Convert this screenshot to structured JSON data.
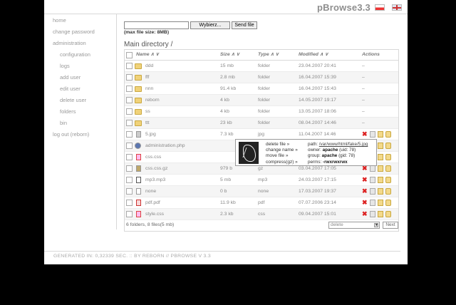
{
  "app": {
    "title": "pBrowse3.3"
  },
  "sidebar": {
    "items": [
      {
        "label": "home",
        "level": "top"
      },
      {
        "label": "change password",
        "level": "top"
      },
      {
        "label": "administration",
        "level": "top"
      },
      {
        "label": "configuration",
        "level": "sub"
      },
      {
        "label": "logs",
        "level": "sub"
      },
      {
        "label": "add user",
        "level": "sub"
      },
      {
        "label": "edit user",
        "level": "sub"
      },
      {
        "label": "delete user",
        "level": "sub"
      },
      {
        "label": "folders",
        "level": "sub"
      },
      {
        "label": "bin",
        "level": "sub"
      },
      {
        "label": "log out (reborn)",
        "level": "top"
      }
    ]
  },
  "upload": {
    "browse_label": "Wybierz...",
    "send_label": "Send file",
    "max_size": "(max file size: 8MB)"
  },
  "directory": {
    "title": "Main directory /"
  },
  "table": {
    "headers": {
      "name": "Name ∧ ∨",
      "size": "Size ∧ ∨",
      "type": "Type ∧ ∨",
      "modified": "Modified ∧ ∨",
      "actions": "Actions"
    },
    "rows": [
      {
        "name": "ddd",
        "size": "15 mb",
        "type": "folder",
        "modified": "23.04.2007 20:41",
        "actions": "–",
        "icon": "folder-icon",
        "kind": "folder"
      },
      {
        "name": "fff",
        "size": "2.8 mb",
        "type": "folder",
        "modified": "16.04.2007 15:39",
        "actions": "–",
        "icon": "folder-icon",
        "kind": "folder"
      },
      {
        "name": "nnn",
        "size": "91.4 kb",
        "type": "folder",
        "modified": "16.04.2007 15:43",
        "actions": "–",
        "icon": "folder-icon",
        "kind": "folder"
      },
      {
        "name": "reborn",
        "size": "4 kb",
        "type": "folder",
        "modified": "14.05.2007 19:17",
        "actions": "–",
        "icon": "folder-icon",
        "kind": "folder"
      },
      {
        "name": "ss",
        "size": "4 kb",
        "type": "folder",
        "modified": "13.05.2007 18:06",
        "actions": "–",
        "icon": "folder-icon",
        "kind": "folder"
      },
      {
        "name": "ttt",
        "size": "23 kb",
        "type": "folder",
        "modified": "08.04.2007 14:46",
        "actions": "–",
        "icon": "folder-icon",
        "kind": "folder"
      },
      {
        "name": "5.jpg",
        "size": "7.3 kb",
        "type": "jpg",
        "modified": "11.04.2007 14:46",
        "icon": "image-file-icon",
        "kind": "img"
      },
      {
        "name": "administration.php",
        "size": "",
        "type": "",
        "modified": "",
        "icon": "php-file-icon",
        "kind": "php"
      },
      {
        "name": "css.css",
        "size": "",
        "type": "",
        "modified": "",
        "icon": "css-file-icon",
        "kind": "css"
      },
      {
        "name": "css.css.gz",
        "size": "979 b",
        "type": "gz",
        "modified": "03.04.2007 17:05",
        "icon": "archive-file-icon",
        "kind": "gz"
      },
      {
        "name": "mp3.mp3",
        "size": "5 mb",
        "type": "mp3",
        "modified": "24.03.2007 17:15",
        "icon": "audio-file-icon",
        "kind": "mp3"
      },
      {
        "name": "none",
        "size": "0 b",
        "type": "none",
        "modified": "17.03.2007 19:37",
        "icon": "blank-file-icon",
        "kind": "none"
      },
      {
        "name": "pdf.pdf",
        "size": "11.9 kb",
        "type": "pdf",
        "modified": "07.07.2006 23:14",
        "icon": "pdf-file-icon",
        "kind": "pdf"
      },
      {
        "name": "style.css",
        "size": "2.3 kb",
        "type": "css",
        "modified": "09.04.2007 15:01",
        "icon": "css-file-icon",
        "kind": "css"
      }
    ],
    "summary": "6 folders, 8 files(5 mb)",
    "bulk_action": "delete",
    "next_label": "Next"
  },
  "popup": {
    "menu": [
      "delete file »",
      "change name »",
      "move file »",
      "compress(gz) »"
    ],
    "path_label": "path:",
    "path_value": "/var/www/html/fake/5.jpg",
    "owner_label": "owner:",
    "owner_value": "apache",
    "owner_uid": "(uid: 78)",
    "group_label": "group:",
    "group_value": "apache",
    "group_gid": "(gid: 78)",
    "perms_label": "perms:",
    "perms_value": "-rwxrwxrwx"
  },
  "footer": {
    "generated": "GENERATED IN: 0,32339 SEC. :: BY REBORN // PBROWSE V 3.3"
  },
  "colors": {
    "folder": "#f0d27a",
    "delete": "#dd2222",
    "border": "#d8d8d8"
  }
}
